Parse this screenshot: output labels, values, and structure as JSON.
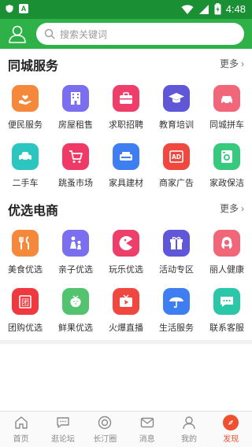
{
  "status_bar": {
    "time": "4:48",
    "badge_a": "A",
    "colors": {
      "bg": "#1b8f34"
    }
  },
  "header": {
    "search_placeholder": "搜索关键词",
    "colors": {
      "bg": "#2eb248"
    },
    "icons": [
      "user-icon",
      "search-icon"
    ]
  },
  "sections": [
    {
      "title": "同城服务",
      "more": "更多",
      "items": [
        {
          "label": "便民服务",
          "icon": "hand-heart-icon",
          "color": "#f5883a"
        },
        {
          "label": "房屋租售",
          "icon": "building-icon",
          "color": "#7b6ff0"
        },
        {
          "label": "求职招聘",
          "icon": "briefcase-icon",
          "color": "#ee3e6a"
        },
        {
          "label": "教育培训",
          "icon": "graduation-cap-icon",
          "color": "#5f57d8"
        },
        {
          "label": "同城拼车",
          "icon": "car-icon",
          "color": "#f2667a"
        },
        {
          "label": "二手车",
          "icon": "used-car-icon",
          "color": "#2cc6c0"
        },
        {
          "label": "跳蚤市场",
          "icon": "cart-icon",
          "color": "#ef3a67"
        },
        {
          "label": "家具建材",
          "icon": "sofa-icon",
          "color": "#3f7ef0"
        },
        {
          "label": "商家广告",
          "icon": "ad-icon",
          "color": "#f0483f"
        },
        {
          "label": "家政保洁",
          "icon": "washer-icon",
          "color": "#37c97e"
        }
      ]
    },
    {
      "title": "优选电商",
      "more": "更多",
      "items": [
        {
          "label": "美食优选",
          "icon": "cutlery-icon",
          "color": "#f5883a"
        },
        {
          "label": "亲子优选",
          "icon": "parent-child-icon",
          "color": "#7b6ff0"
        },
        {
          "label": "玩乐优选",
          "icon": "pacman-icon",
          "color": "#ee3e6a"
        },
        {
          "label": "活动专区",
          "icon": "gift-icon",
          "color": "#5f57d8"
        },
        {
          "label": "丽人健康",
          "icon": "woman-icon",
          "color": "#f2667a"
        },
        {
          "label": "团购优选",
          "icon": "group-buy-icon",
          "color": "#f0383f"
        },
        {
          "label": "鲜果优选",
          "icon": "strawberry-icon",
          "color": "#54c36f"
        },
        {
          "label": "火爆直播",
          "icon": "live-tv-icon",
          "color": "#f0483f"
        },
        {
          "label": "生活服务",
          "icon": "umbrella-icon",
          "color": "#3f7ef0"
        },
        {
          "label": "联系客服",
          "icon": "chat-bubble-icon",
          "color": "#2cc6a8"
        }
      ]
    }
  ],
  "tabbar": {
    "tabs": [
      {
        "label": "首页",
        "icon": "home-icon"
      },
      {
        "label": "逛论坛",
        "icon": "forum-icon"
      },
      {
        "label": "长汀圈",
        "icon": "circle-icon"
      },
      {
        "label": "消息",
        "icon": "mail-icon"
      },
      {
        "label": "我的",
        "icon": "profile-icon"
      },
      {
        "label": "发现",
        "icon": "discover-icon",
        "active": true
      }
    ],
    "colors": {
      "active": "#ef5030",
      "inactive": "#888888"
    }
  }
}
